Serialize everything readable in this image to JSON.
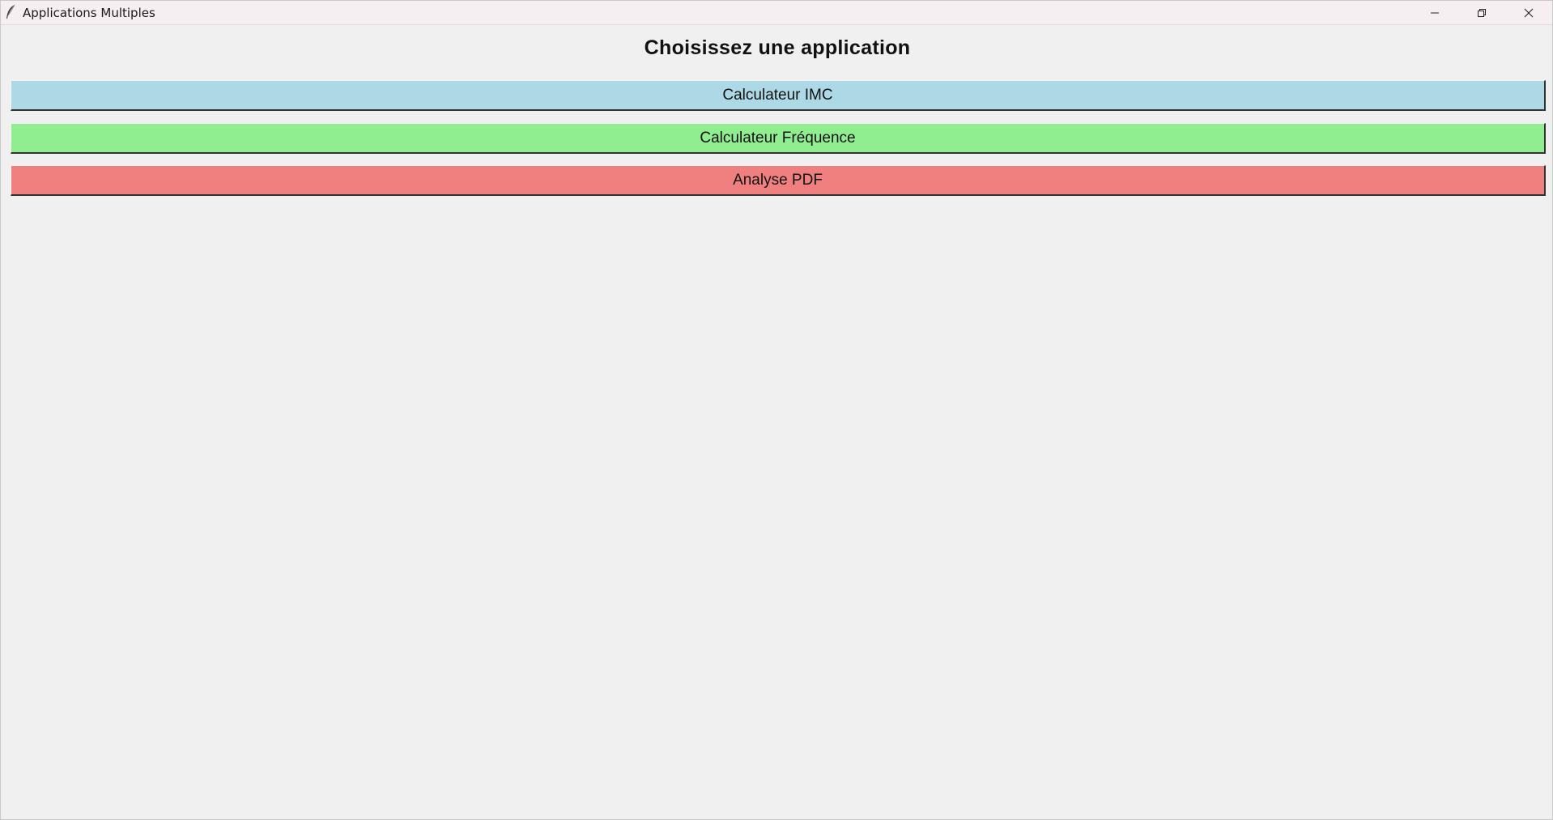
{
  "window": {
    "title": "Applications Multiples",
    "icon": "feather-icon"
  },
  "controls": {
    "minimize_icon": "minimize-icon",
    "maximize_icon": "restore-icon",
    "close_icon": "close-icon"
  },
  "main": {
    "heading": "Choisissez une application",
    "buttons": [
      {
        "label": "Calculateur IMC",
        "color": "#add8e6"
      },
      {
        "label": "Calculateur Fréquence",
        "color": "#90ee90"
      },
      {
        "label": "Analyse PDF",
        "color": "#f08080"
      }
    ]
  }
}
